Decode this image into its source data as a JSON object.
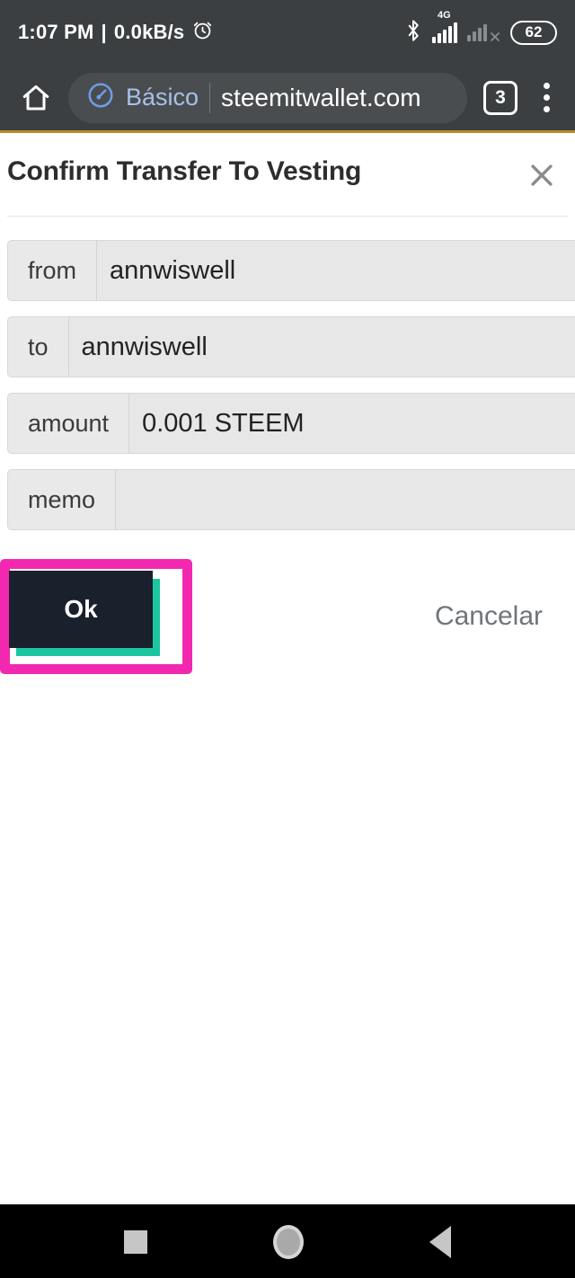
{
  "status_bar": {
    "time": "1:07 PM",
    "separator": "|",
    "network_speed": "0.0kB/s",
    "alarm_icon": "alarm-clock-icon",
    "bluetooth_icon": "bluetooth-icon",
    "signal_label": "4G",
    "battery_level": "62"
  },
  "browser": {
    "home_icon": "home-icon",
    "data_saver_icon": "speedometer-icon",
    "data_saver_label": "Básico",
    "url": "steemitwallet.com",
    "tab_count": "3",
    "overflow_icon": "overflow-menu-icon",
    "chrome_bg": "#3c3f41",
    "accent_underline": "#b58b27"
  },
  "dialog": {
    "title": "Confirm Transfer To Vesting",
    "close_icon": "close-icon",
    "fields": [
      {
        "label": "from",
        "value": "annwiswell"
      },
      {
        "label": "to",
        "value": "annwiswell"
      },
      {
        "label": "amount",
        "value": "0.001 STEEM"
      },
      {
        "label": "memo",
        "value": ""
      }
    ],
    "actions": {
      "ok_label": "Ok",
      "cancel_label": "Cancelar",
      "ok_bg": "#1a202c",
      "ok_shadow": "#1bc5a0",
      "highlight_color": "#f229b0",
      "cancel_color": "#6e757c"
    }
  },
  "nav_bar": {
    "recents_icon": "square-recents-icon",
    "home_icon": "circle-home-icon",
    "back_icon": "triangle-back-icon"
  }
}
